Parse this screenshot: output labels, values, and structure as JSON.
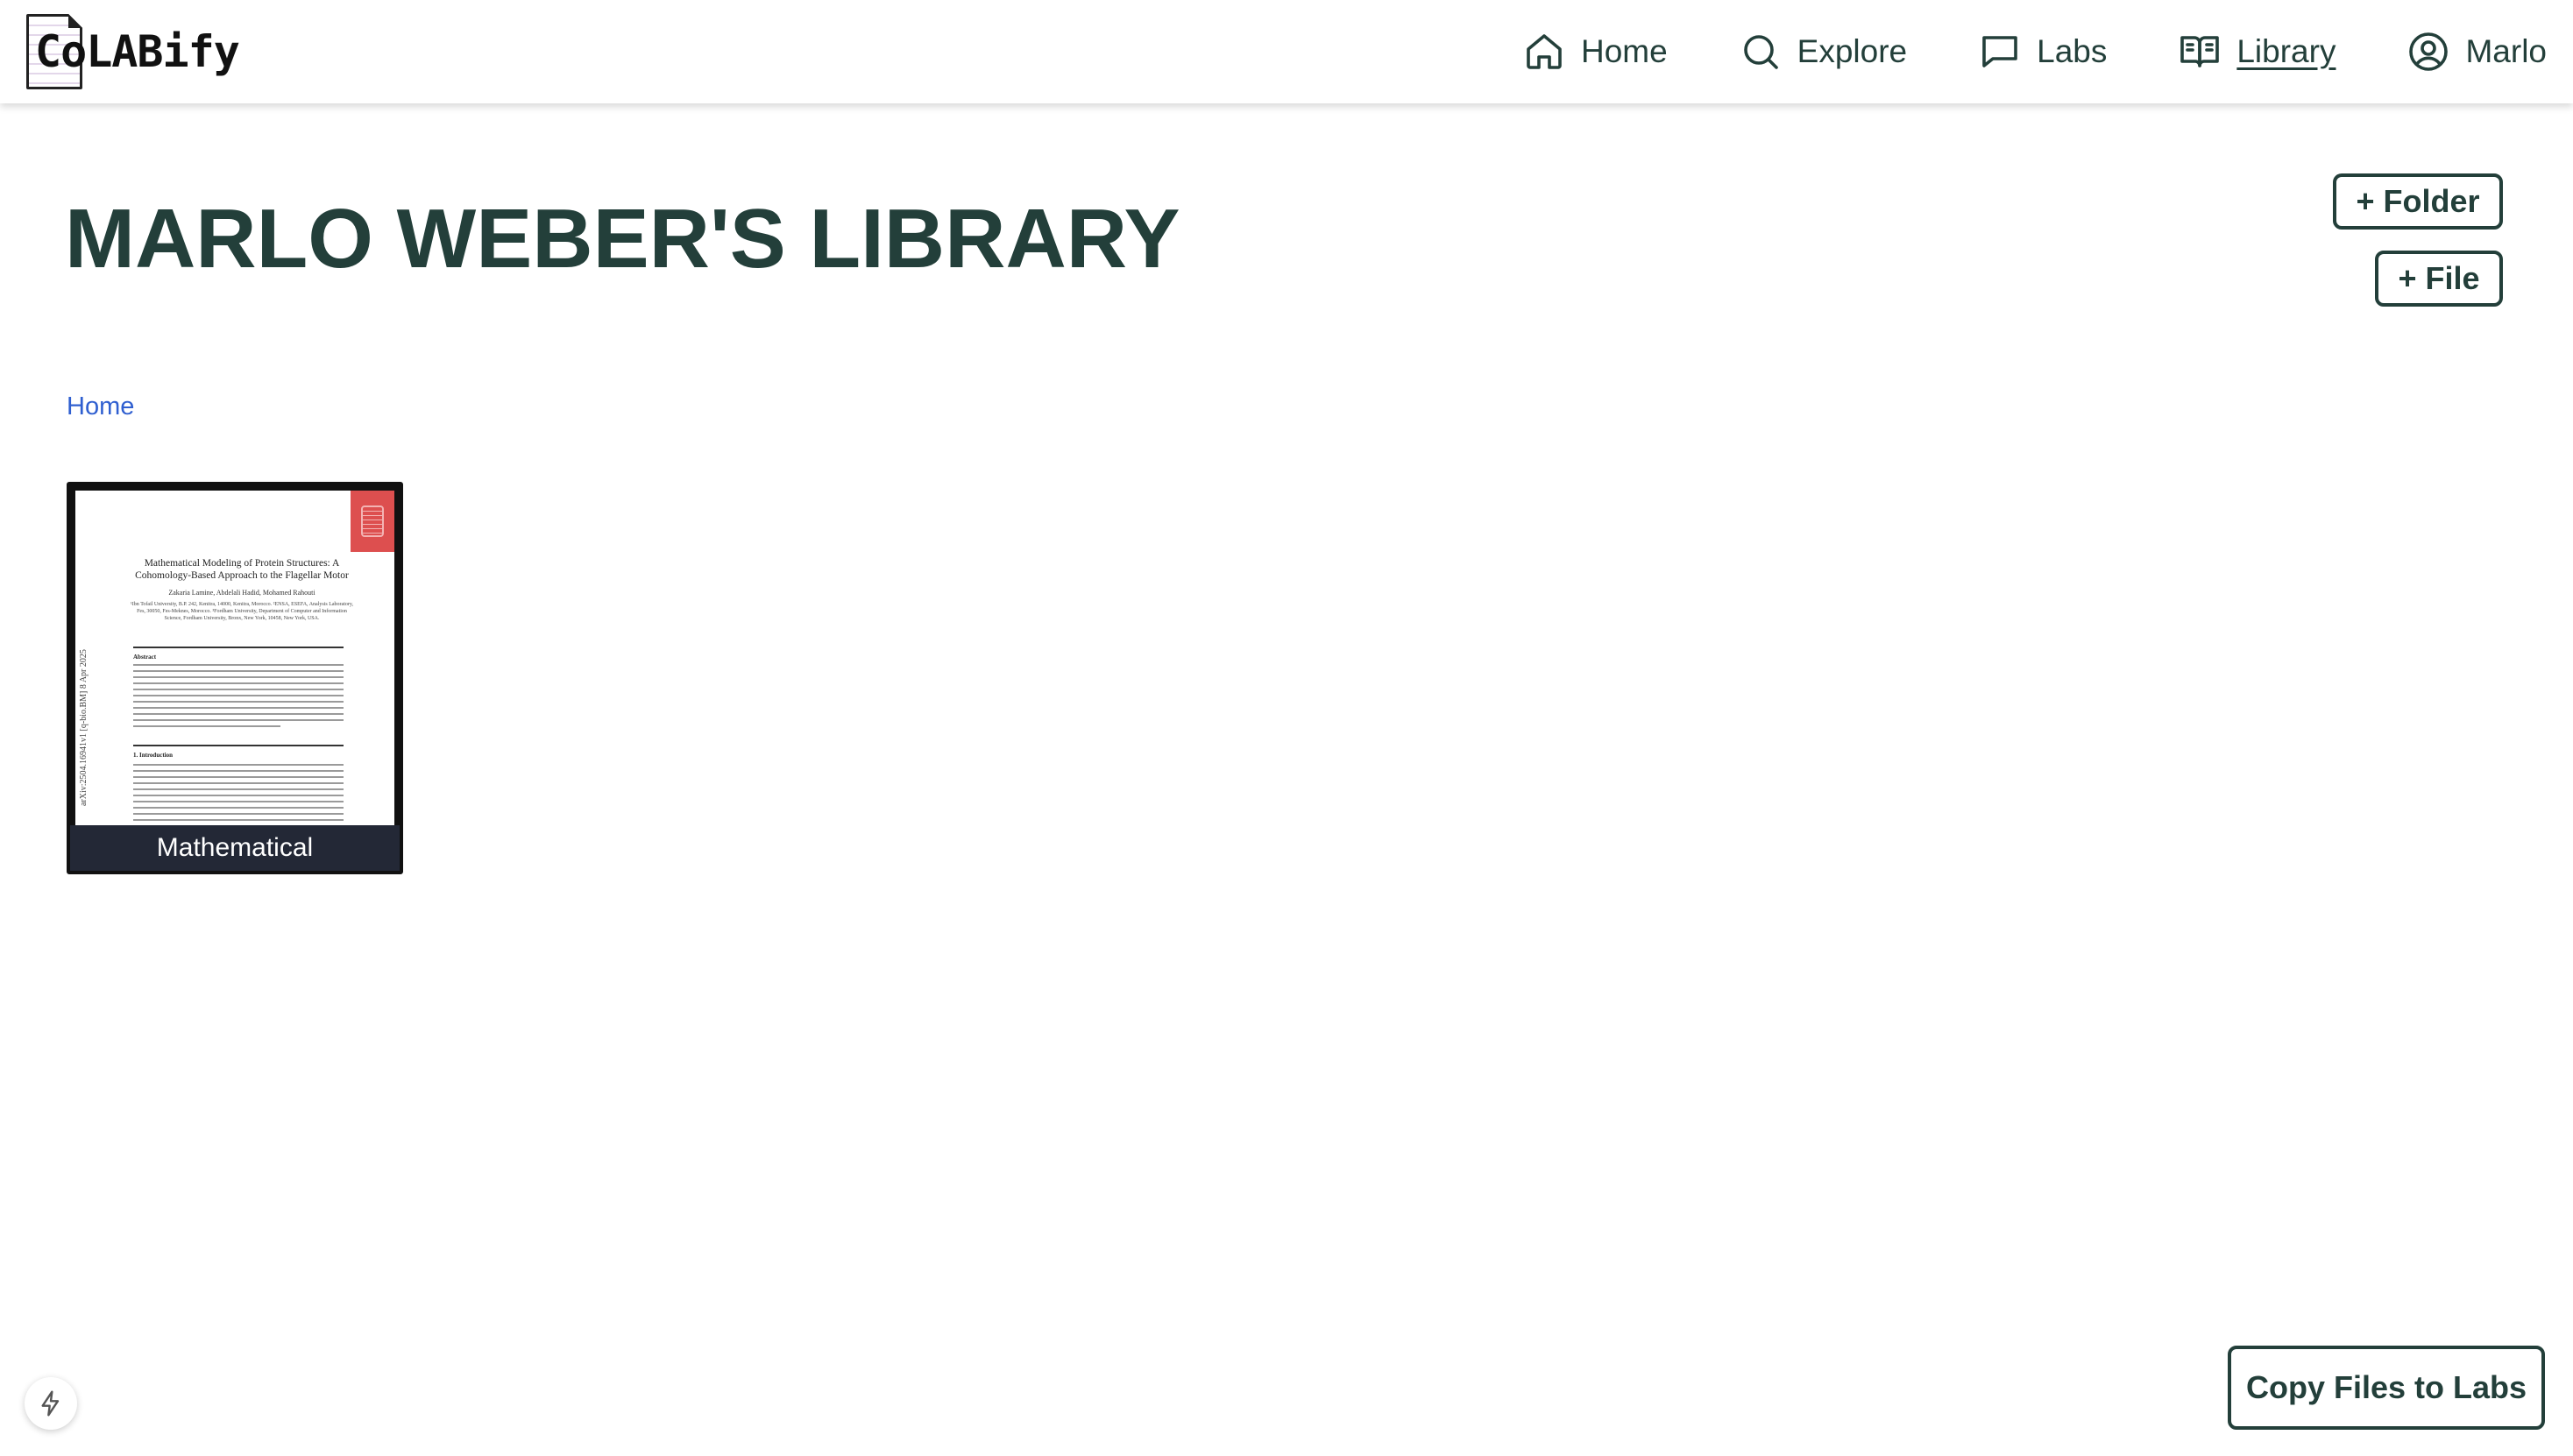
{
  "app": {
    "logo_text": "CoLABify"
  },
  "nav": {
    "items": [
      {
        "label": "Home",
        "icon": "home-icon"
      },
      {
        "label": "Explore",
        "icon": "search-icon"
      },
      {
        "label": "Labs",
        "icon": "chat-bubble-icon"
      },
      {
        "label": "Library",
        "icon": "book-open-icon",
        "active": true
      },
      {
        "label": "Marlo",
        "icon": "user-circle-icon"
      }
    ]
  },
  "page": {
    "title": "MARLO WEBER'S LIBRARY"
  },
  "actions": {
    "folder_label": "+ Folder",
    "file_label": "+ File"
  },
  "breadcrumb": {
    "home": "Home"
  },
  "files": [
    {
      "name": "Mathematical",
      "thumbnail": {
        "side_text": "arXiv:2504.16941v1 [q-bio.BM] 8 Apr 2025",
        "title": "Mathematical Modeling of Protein Structures: A Cohomology-Based Approach to the Flagellar Motor",
        "authors": "Zakaria Lamine, Abdelali Hadid, Mohamed Rahouti",
        "affiliation": "¹Ibn Tofail University, B.P. 242, Kenitra, 14000, Kenitra, Morocco. ²ENSA, ESEFA, Analysis Laboratory, Fes, 30050, Fes-Meknes, Morocco. ³Fordham University, Department of Computer and Information Science, Fordham University, Bronx, New York, 10458, New York, USA.",
        "abstract_heading": "Abstract",
        "intro_heading": "1. Introduction"
      }
    }
  ],
  "footer": {
    "copy_label": "Copy Files to Labs",
    "bolt_icon": "lightning-icon"
  },
  "colors": {
    "primary": "#233f3a",
    "link": "#2f5fd0",
    "caption_bg": "#232836",
    "badge": "#dd4f4f"
  }
}
